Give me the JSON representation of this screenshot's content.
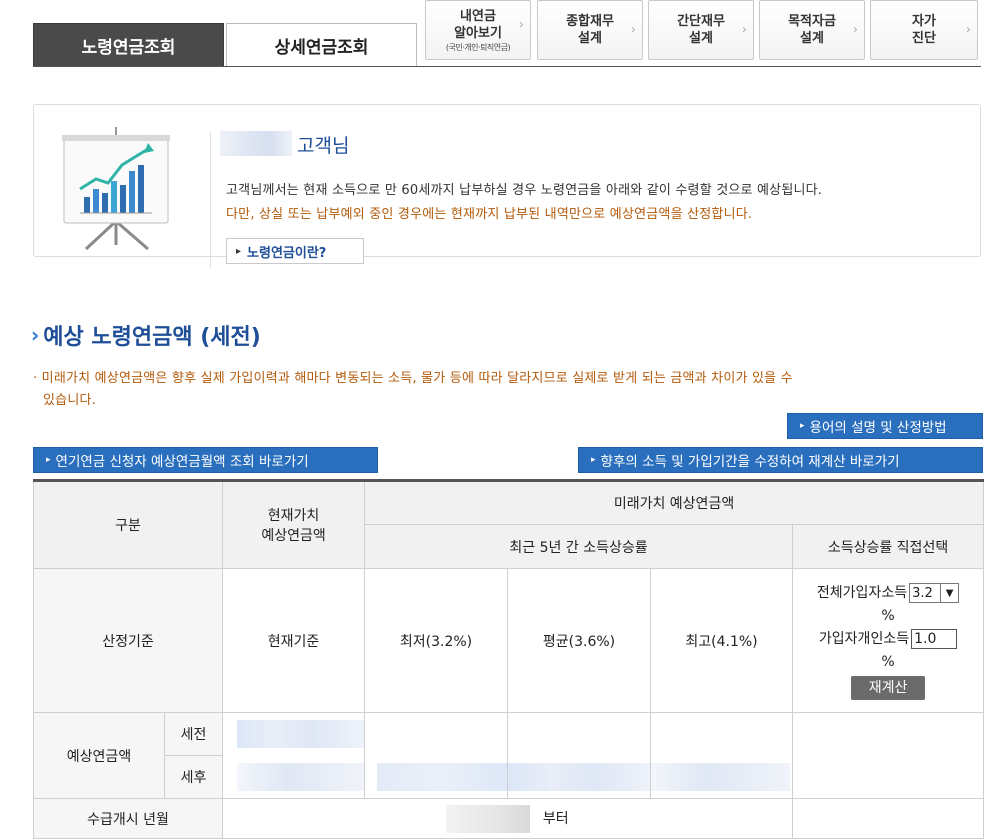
{
  "tabs": {
    "active": "노령연금조회",
    "inactive": "상세연금조회",
    "small": [
      {
        "line1": "내연금",
        "line2": "알아보기",
        "sub": "(국민·개인·퇴직연금)"
      },
      {
        "line1": "종합재무",
        "line2": "설계",
        "sub": ""
      },
      {
        "line1": "간단재무",
        "line2": "설계",
        "sub": ""
      },
      {
        "line1": "목적자금",
        "line2": "설계",
        "sub": ""
      },
      {
        "line1": "자가",
        "line2": "진단",
        "sub": ""
      }
    ],
    "chevron": "›"
  },
  "panel": {
    "customer_suffix": "고객님",
    "message1": "고객님께서는 현재 소득으로 만 60세까지 납부하실 경우 노령연금을 아래와 같이 수령할 것으로 예상됩니다.",
    "message2": "다만, 상실 또는 납부예외 중인 경우에는 현재까지 납부된 내역만으로 예상연금액을 산정합니다.",
    "what_button": "노령연금이란?",
    "icon": "presentation-chart-icon"
  },
  "section": {
    "title": "예상 노령연금액 (세전)",
    "notice_line1": "· 미래가치 예상연금액은 향후 실제 가입이력과 해마다 변동되는 소득, 물가 등에 따라 달라지므로 실제로 받게 되는 금액과 차이가 있을 수",
    "notice_line2": "있습니다."
  },
  "buttons": {
    "terms": "용어의 설명 및 산정방법",
    "early": "연기연금 신청자 예상연금월액 조회 바로가기",
    "recalc_link": "향후의 소득 및 가입기간을 수정하여 재계산 바로가기"
  },
  "table": {
    "h_category": "구분",
    "h_present_line1": "현재가치",
    "h_present_line2": "예상연금액",
    "h_future": "미래가치 예상연금액",
    "h_recent": "최근 5년 간 소득상승률",
    "h_direct": "소득상승률 직접선택",
    "r_basis": "산정기준",
    "basis_present": "현재기준",
    "basis_low": "최저(3.2%)",
    "basis_avg": "평균(3.6%)",
    "basis_high": "최고(4.1%)",
    "all_income_label": "전체가입자소득",
    "all_income_value": "3.2",
    "percent": "%",
    "personal_income_label": "가입자개인소득",
    "personal_income_value": "1.0",
    "recalc_button": "재계산",
    "r_expected": "예상연금액",
    "pre_tax": "세전",
    "post_tax": "세후",
    "r_start": "수급개시 년월",
    "start_suffix": "부터"
  },
  "colors": {
    "brand_blue": "#2a6fbe",
    "title_blue": "#1f4e99",
    "warning_orange": "#b35a0a",
    "tab_dark": "#4a4a4a"
  }
}
